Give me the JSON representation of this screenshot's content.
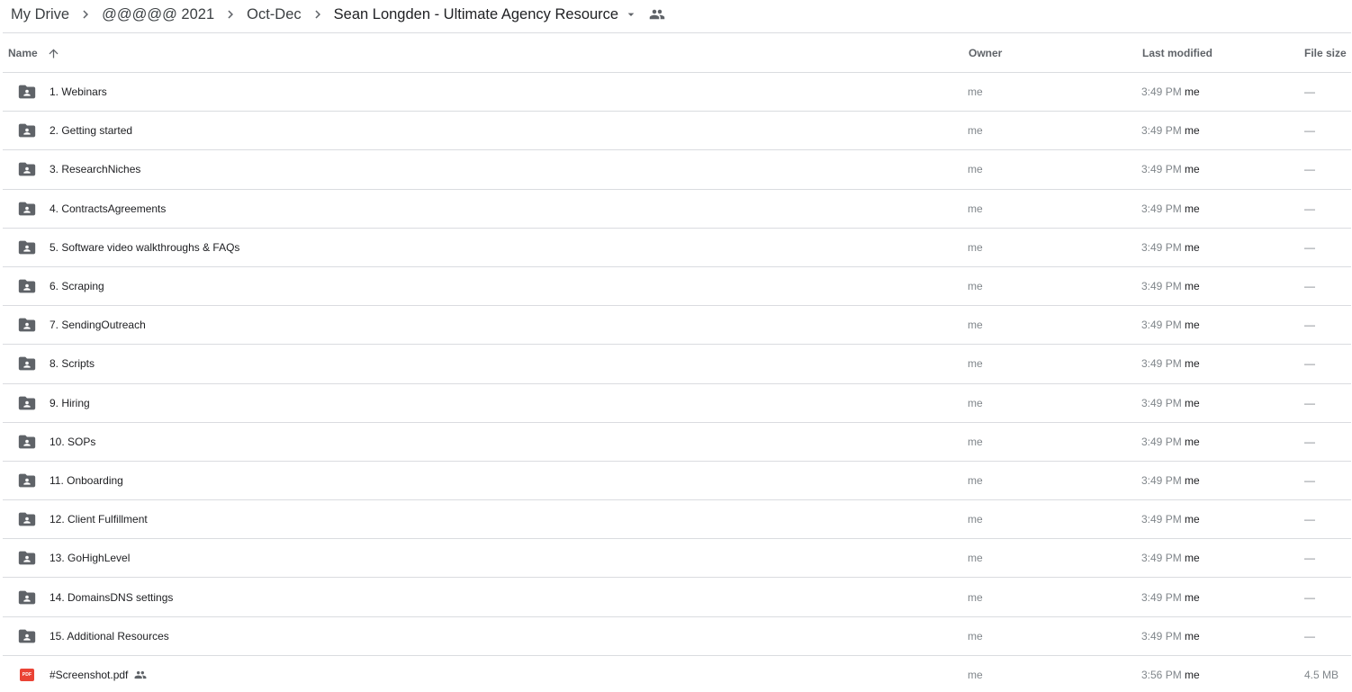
{
  "breadcrumb": {
    "items": [
      "My Drive",
      "@@@@@ 2021",
      "Oct-Dec",
      "Sean Longden - Ultimate Agency Resource"
    ]
  },
  "table": {
    "headers": {
      "name": "Name",
      "owner": "Owner",
      "last_modified": "Last modified",
      "file_size": "File size"
    },
    "sort": {
      "column": "name",
      "direction": "ascending"
    },
    "rows": [
      {
        "type": "shared-folder",
        "name": "1.  Webinars",
        "owner": "me",
        "time": "3:49 PM",
        "by": "me",
        "size": "—"
      },
      {
        "type": "shared-folder",
        "name": "2.  Getting started",
        "owner": "me",
        "time": "3:49 PM",
        "by": "me",
        "size": "—"
      },
      {
        "type": "shared-folder",
        "name": "3. ResearchNiches",
        "owner": "me",
        "time": "3:49 PM",
        "by": "me",
        "size": "—"
      },
      {
        "type": "shared-folder",
        "name": "4. ContractsAgreements",
        "owner": "me",
        "time": "3:49 PM",
        "by": "me",
        "size": "—"
      },
      {
        "type": "shared-folder",
        "name": "5. Software video walkthroughs & FAQs",
        "owner": "me",
        "time": "3:49 PM",
        "by": "me",
        "size": "—"
      },
      {
        "type": "shared-folder",
        "name": "6. Scraping",
        "owner": "me",
        "time": "3:49 PM",
        "by": "me",
        "size": "—"
      },
      {
        "type": "shared-folder",
        "name": "7. SendingOutreach",
        "owner": "me",
        "time": "3:49 PM",
        "by": "me",
        "size": "—"
      },
      {
        "type": "shared-folder",
        "name": "8. Scripts",
        "owner": "me",
        "time": "3:49 PM",
        "by": "me",
        "size": "—"
      },
      {
        "type": "shared-folder",
        "name": "9. Hiring",
        "owner": "me",
        "time": "3:49 PM",
        "by": "me",
        "size": "—"
      },
      {
        "type": "shared-folder",
        "name": "10. SOPs",
        "owner": "me",
        "time": "3:49 PM",
        "by": "me",
        "size": "—"
      },
      {
        "type": "shared-folder",
        "name": "11. Onboarding",
        "owner": "me",
        "time": "3:49 PM",
        "by": "me",
        "size": "—"
      },
      {
        "type": "shared-folder",
        "name": "12. Client Fulfillment",
        "owner": "me",
        "time": "3:49 PM",
        "by": "me",
        "size": "—"
      },
      {
        "type": "shared-folder",
        "name": "13. GoHighLevel",
        "owner": "me",
        "time": "3:49 PM",
        "by": "me",
        "size": "—"
      },
      {
        "type": "shared-folder",
        "name": "14. DomainsDNS settings",
        "owner": "me",
        "time": "3:49 PM",
        "by": "me",
        "size": "—"
      },
      {
        "type": "shared-folder",
        "name": "15. Additional Resources",
        "owner": "me",
        "time": "3:49 PM",
        "by": "me",
        "size": "—"
      },
      {
        "type": "pdf",
        "name": "#Screenshot.pdf",
        "shared": true,
        "badge": "PDF",
        "owner": "me",
        "time": "3:56 PM",
        "by": "me",
        "size": "4.5 MB"
      }
    ]
  },
  "colors": {
    "folder_icon": "#5f6368",
    "pdf_icon": "#ea4335",
    "divider": "#dadce0",
    "secondary_text": "#80868b"
  }
}
